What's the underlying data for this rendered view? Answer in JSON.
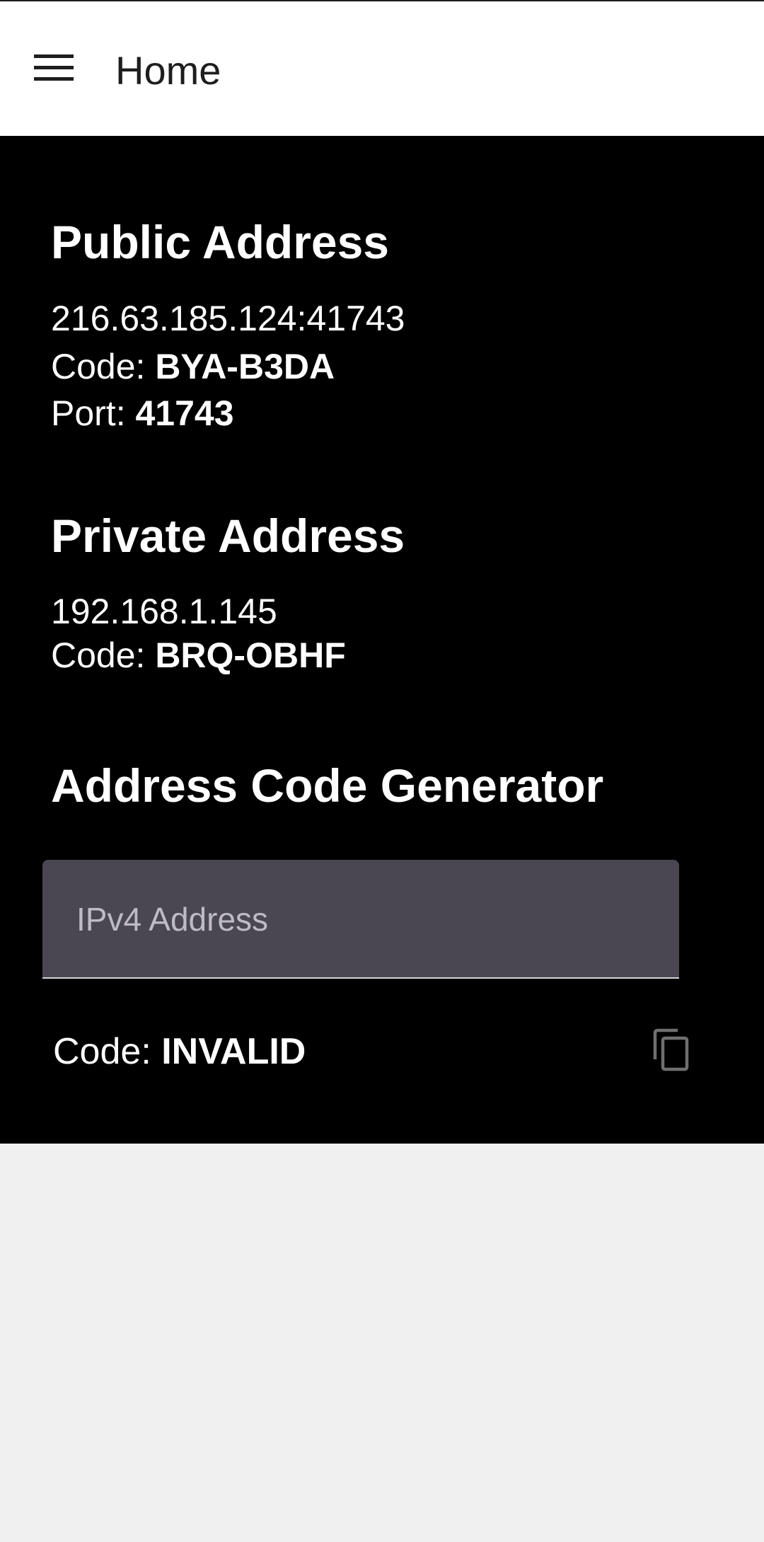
{
  "app_bar": {
    "title": "Home",
    "menu_icon": "hamburger-menu-icon"
  },
  "public_address": {
    "heading": "Public Address",
    "address": "216.63.185.124:41743",
    "code_label": "Code: ",
    "code": "BYA-B3DA",
    "port_label": "Port: ",
    "port": "41743"
  },
  "private_address": {
    "heading": "Private Address",
    "address": "192.168.1.145",
    "code_label": "Code: ",
    "code": "BRQ-OBHF"
  },
  "generator": {
    "heading": "Address Code Generator",
    "input_placeholder": "IPv4 Address",
    "input_value": "",
    "code_label": "Code: ",
    "code": "INVALID",
    "copy_icon": "copy-icon"
  },
  "colors": {
    "content_background": "#000000",
    "app_bar_background": "#ffffff",
    "field_background": "#4a4752",
    "page_background": "#f0f0f0"
  }
}
